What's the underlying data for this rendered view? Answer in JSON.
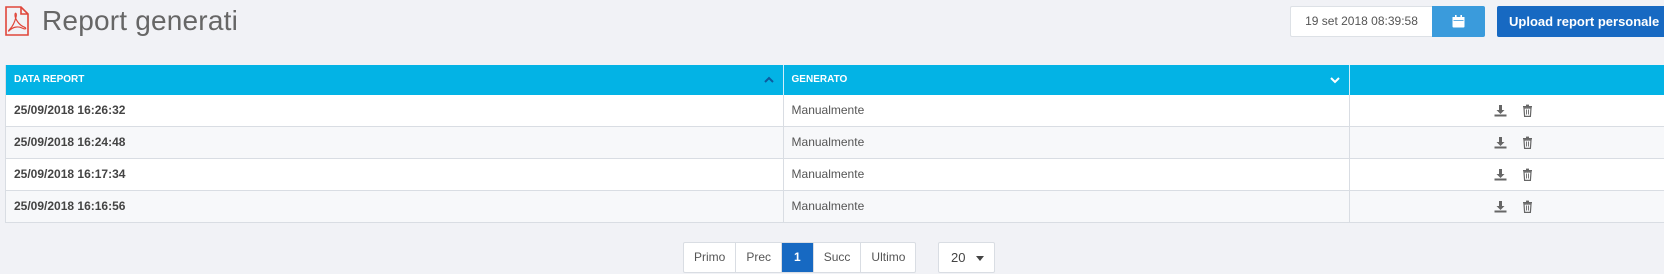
{
  "header": {
    "title": "Report generati",
    "date_value": "19 set 2018 08:39:58",
    "calendar_icon": "calendar-icon",
    "upload_label": "Upload report personale"
  },
  "table": {
    "columns": [
      {
        "label": "DATA REPORT",
        "sort": "asc"
      },
      {
        "label": "GENERATO",
        "sort": "desc"
      },
      {
        "label": ""
      }
    ],
    "rows": [
      {
        "date": "25/09/2018 16:26:32",
        "generated": "Manualmente"
      },
      {
        "date": "25/09/2018 16:24:48",
        "generated": "Manualmente"
      },
      {
        "date": "25/09/2018 16:17:34",
        "generated": "Manualmente"
      },
      {
        "date": "25/09/2018 16:16:56",
        "generated": "Manualmente"
      }
    ]
  },
  "pagination": {
    "first": "Primo",
    "prev": "Prec",
    "current": "1",
    "next": "Succ",
    "last": "Ultimo",
    "page_size": "20"
  },
  "colors": {
    "header_bg": "#03b3e5",
    "primary": "#1769c2",
    "calendar_btn": "#3a9bdc",
    "pdf_icon": "#e0463a"
  }
}
